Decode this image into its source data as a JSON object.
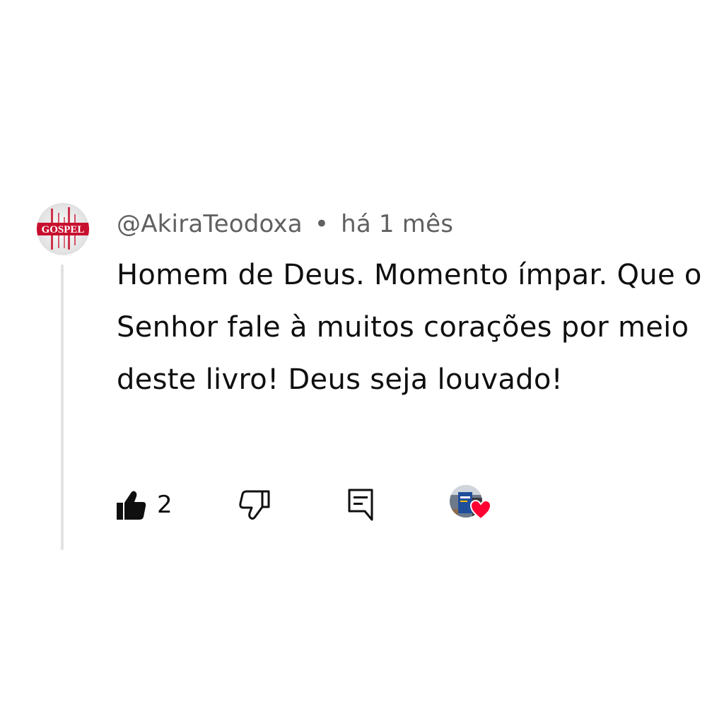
{
  "comment": {
    "author": "@AkiraTeodoxa",
    "separator": "•",
    "time": "há 1 mês",
    "text": "Homem de Deus. Momento ímpar. Que o Senhor fale à muitos corações por meio deste livro! Deus seja louvado!",
    "avatar_logo_text": "GOSPEL"
  },
  "actions": {
    "like_icon": "thumbs-up-filled-icon",
    "like_count": "2",
    "dislike_icon": "thumbs-down-outline-icon",
    "reply_icon": "reply-comment-icon",
    "creator_heart_icon": "creator-heart-icon"
  },
  "colors": {
    "text_primary": "#0f0f0f",
    "text_secondary": "#606060",
    "thread_line": "#e2e2e2",
    "heart": "#ff0033",
    "avatar_red": "#c8102e"
  }
}
